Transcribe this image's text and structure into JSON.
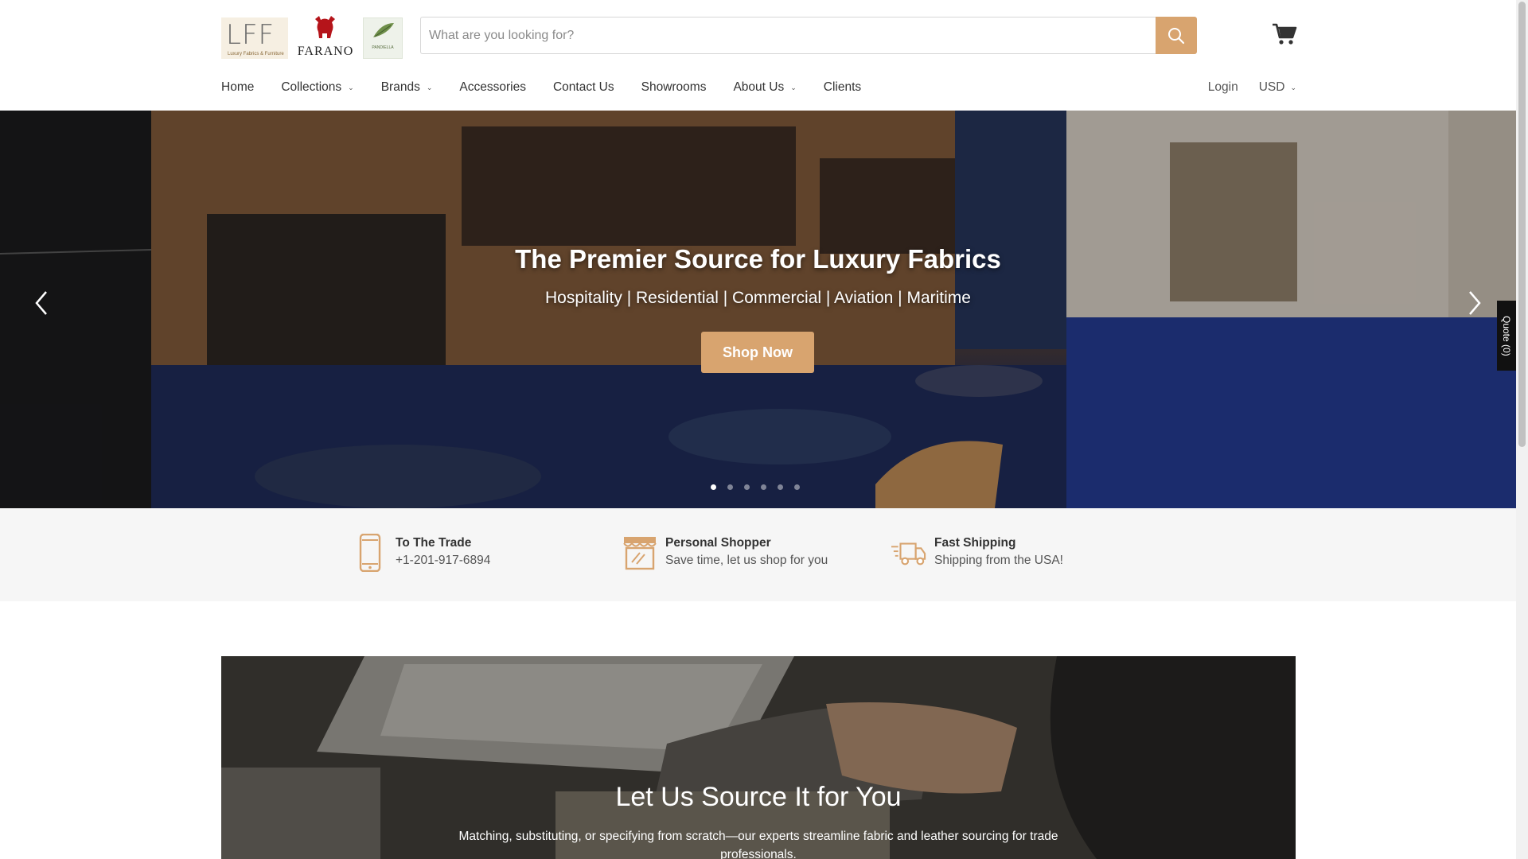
{
  "search": {
    "placeholder": "What are you looking for?"
  },
  "logos": {
    "lff_text": "LFF",
    "lff_sub": "Luxury Fabrics & Furniture",
    "farano_text": "FARANO",
    "pf_text": "PANDIELLA"
  },
  "nav": {
    "items": [
      {
        "label": "Home",
        "has_dropdown": false
      },
      {
        "label": "Collections",
        "has_dropdown": true
      },
      {
        "label": "Brands",
        "has_dropdown": true
      },
      {
        "label": "Accessories",
        "has_dropdown": false
      },
      {
        "label": "Contact Us",
        "has_dropdown": false
      },
      {
        "label": "Showrooms",
        "has_dropdown": false
      },
      {
        "label": "About Us",
        "has_dropdown": true
      },
      {
        "label": "Clients",
        "has_dropdown": false
      }
    ],
    "login": "Login",
    "currency": "USD"
  },
  "hero": {
    "title": "The Premier Source for Luxury Fabrics",
    "subtitle": "Hospitality | Residential | Commercial | Aviation | Maritime",
    "cta": "Shop Now",
    "slide_count": 6,
    "active_slide": 1
  },
  "quote_tab": "Quote (0)",
  "features": [
    {
      "icon": "phone-icon",
      "title": "To The Trade",
      "desc": "+1-201-917-6894"
    },
    {
      "icon": "storefront-icon",
      "title": "Personal Shopper",
      "desc": "Save time, let us shop for you"
    },
    {
      "icon": "truck-icon",
      "title": "Fast Shipping",
      "desc": "Shipping from the USA!"
    }
  ],
  "source": {
    "title": "Let Us Source It for You",
    "desc": "Matching, substituting, or specifying from scratch—our experts streamline fabric and leather sourcing for trade professionals."
  },
  "colors": {
    "accent": "#d8a46f",
    "feature_bg": "#f6f6f6"
  }
}
